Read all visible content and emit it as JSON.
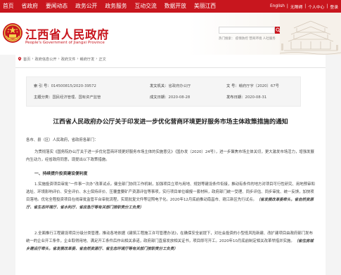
{
  "nav": {
    "items": [
      "首页",
      "省政府",
      "要闻动态",
      "政务公开",
      "政务服务",
      "互动交流",
      "数据开放",
      "美丽江西"
    ],
    "util": [
      "English",
      "|",
      "无障碍",
      "|",
      "个人中心",
      "|",
      "登录"
    ]
  },
  "header": {
    "title": "江西省人民政府",
    "subtitle": "People's Government of Jiangxi Province",
    "hot": "热门搜索：  疫情防控  营商环境  人社服务"
  },
  "breadcrumb": [
    "首页",
    "政府信息公开",
    "政府文件",
    "赣府厅发",
    "正文"
  ],
  "meta": {
    "label_index": "索  引 号：",
    "index_value": "014500815/2020-39572",
    "label_publisher": "发文机关：",
    "publisher_value": "省政府办公厅",
    "label_docno": "文 号：",
    "docno_value": "赣府厅字〔2020〕67号",
    "label_topic": "主题分类：",
    "topic_value": "国民经济管理、国有资产监管",
    "label_org": "成文日期：",
    "org_value": "2020-08-28",
    "label_date": "发布日期：",
    "date_value": "2020-08-31"
  },
  "doc": {
    "title": "江西省人民政府办公厅关于印发进一步优化营商环境更好服务市场主体政策措施的通知",
    "salutation": "各市、县（区）人民政府，省政府各部门：",
    "p1": "为贯彻落实《国务院办公厅关于进一步优化营商环境更好服务市场主体的实施意见》（国办发〔2020〕24号），进一步聚焦市场主体关切，更大激发市场活力，增强发展内生动力，经省政府同意，现提出以下政策措施。",
    "s1": "一、持续提升投资建设便利度",
    "p2a": "1.实施投资项目审批“一件事一次办”改革试点。健全部门协同工作机制，加强项目立项与用地、规划等建设条件衔接，推动有条件的地方对项目可行性研究、用地预审和选址、环境影响评价、安全评价、水土保持评价、压覆重要矿产资源评估等事项，实行项目单位编报一套材料，政府部门统一受理、同步评估、同步审批、统一反馈，加快项目落地。优化全程投资项目在线审批监管平台审批流程，实现批复文件等证照电子化。2020年12月底前推动南昌市、赣江新区先行试点。",
    "p2b": "（省发展改革委牵头，省自然资源厅、省生态环境厅、省水利厅、省应急厅等有关部门按职责分工负责）",
    "p3a": "2.全面推行工程建设项目分级分类管理。推动各地依据《建筑工程施工许可管理办法》，在确保安全前提下，对社会投资的小型低风险新建、改扩建项目由政府部门发布统一的企业开工条件，企业取得用地、满足开工条件后作出相关承诺，政府部门直接发放相关证书，项目即可开工。2020年10月底前制定相关改革举措并实施。",
    "p3b": "（省住房城乡建设厅牵头，省发展改革委、省自然资源厅、省生态环境厅等有关部门按职责分工负责）"
  },
  "colors": {
    "brand_red": "#c8161e",
    "accent_gold": "#d9a441"
  }
}
